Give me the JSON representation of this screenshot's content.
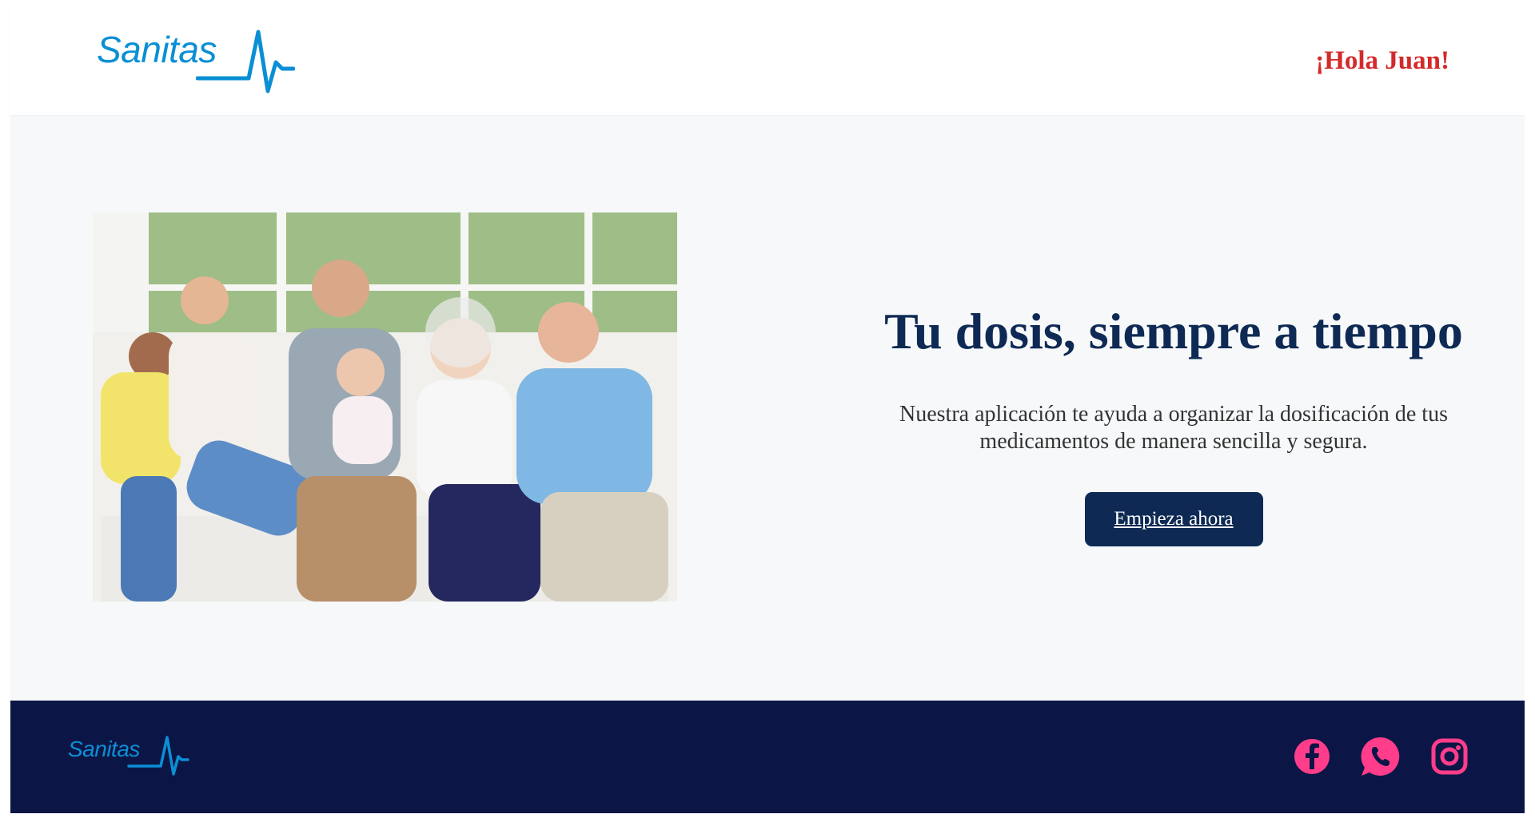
{
  "brand": {
    "name": "Sanitas",
    "color": "#0b8fd4"
  },
  "header": {
    "greeting": "¡Hola Juan!",
    "greeting_color": "#d22b2b"
  },
  "hero": {
    "image_icon": "family-photo",
    "title": "Tu dosis, siempre a tiempo",
    "subtitle": "Nuestra aplicación te ayuda a organizar la dosificación de tus medicamentos de manera sencilla y segura.",
    "cta_label": "Empieza ahora",
    "title_color": "#0e2a54"
  },
  "footer": {
    "background": "#0c1646",
    "social": [
      {
        "name": "facebook-icon",
        "color": "#ff3d8b"
      },
      {
        "name": "whatsapp-icon",
        "color": "#ff3d8b"
      },
      {
        "name": "instagram-icon",
        "color": "#ff3d8b"
      }
    ]
  }
}
